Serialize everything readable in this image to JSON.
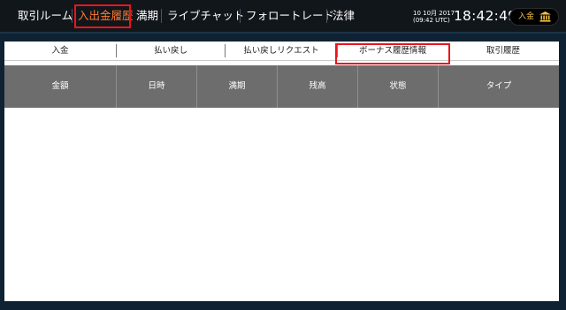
{
  "nav": {
    "items": [
      {
        "label": "取引ルーム"
      },
      {
        "label": "入出金履歴"
      },
      {
        "label": "満期"
      },
      {
        "label": "ライブチャット"
      },
      {
        "label": "フォロートレード"
      },
      {
        "label": "法律"
      }
    ],
    "active_index": 1,
    "date_line1": "10 10月 2017",
    "date_line2": "(09:42 UTC)",
    "time": "18:42:49",
    "deposit_label": "入金",
    "deposit_icon": "bank-icon"
  },
  "tabs": [
    {
      "label": "入金"
    },
    {
      "label": "払い戻し"
    },
    {
      "label": "払い戻しリクエスト"
    },
    {
      "label": "ボーナス履歴情報"
    },
    {
      "label": "取引履歴"
    }
  ],
  "active_tab_index": 3,
  "table": {
    "columns": [
      "金額",
      "日時",
      "満期",
      "残高",
      "状態",
      "タイプ"
    ],
    "rows": []
  },
  "colors": {
    "background": "#0f2233",
    "nav_bar": "#11161b",
    "active_nav_text": "#ff7a2f",
    "highlight_border": "#e8161b",
    "table_header": "#6d6d6d",
    "deposit_text": "#f4c247"
  }
}
